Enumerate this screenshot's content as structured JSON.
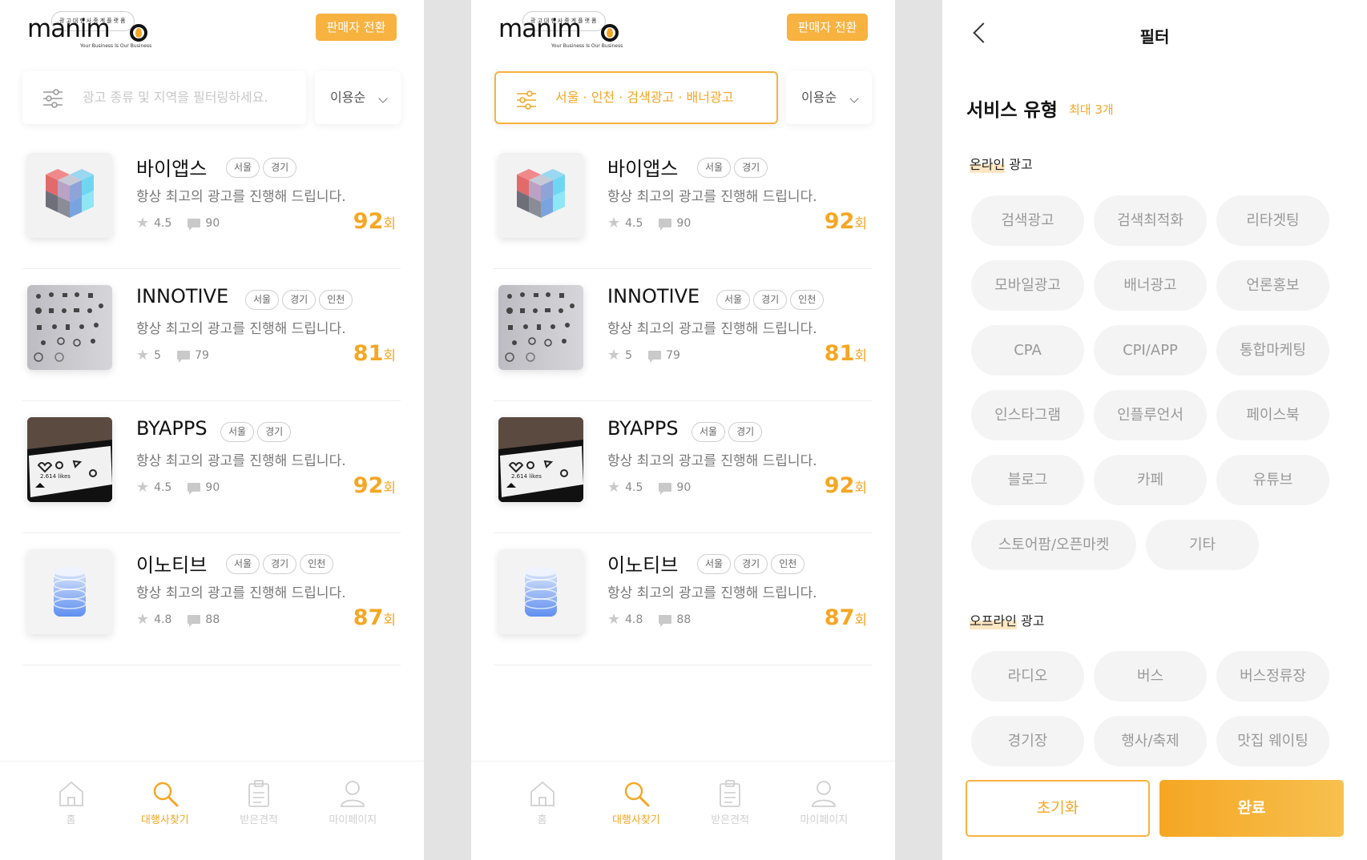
{
  "header": {
    "logo_word": "manim on",
    "logo_tagline": "광고대행사중계플랫폼",
    "logo_sub": "Your Business Is Our Business",
    "seller_switch": "판매자 전환"
  },
  "search": {
    "placeholder": "광고 종류 및 지역을 필터링하세요.",
    "applied": "서울 · 인천 · 검색광고 · 배너광고",
    "sort": "이용순"
  },
  "agencies": [
    {
      "name": "바이앱스",
      "tags": [
        "서울",
        "경기"
      ],
      "desc": "항상 최고의 광고를 진행해 드립니다.",
      "rating": "4.5",
      "reviews": "90",
      "count": "92",
      "unit": "회",
      "thumb": "cube"
    },
    {
      "name": "INNOTIVE",
      "tags": [
        "서울",
        "경기",
        "인천"
      ],
      "desc": "항상 최고의 광고를 진행해 드립니다.",
      "rating": "5",
      "reviews": "79",
      "count": "81",
      "unit": "회",
      "thumb": "icons"
    },
    {
      "name": "BYAPPS",
      "tags": [
        "서울",
        "경기"
      ],
      "desc": "항상 최고의 광고를 진행해 드립니다.",
      "rating": "4.5",
      "reviews": "90",
      "count": "92",
      "unit": "회",
      "thumb": "phone"
    },
    {
      "name": "이노티브",
      "tags": [
        "서울",
        "경기",
        "인천"
      ],
      "desc": "항상 최고의 광고를 진행해 드립니다.",
      "rating": "4.8",
      "reviews": "88",
      "count": "87",
      "unit": "회",
      "thumb": "disks"
    }
  ],
  "tabbar": [
    {
      "label": "홈",
      "icon": "home-icon",
      "active": false
    },
    {
      "label": "대행사찾기",
      "icon": "search-icon",
      "active": true
    },
    {
      "label": "받은견적",
      "icon": "clipboard-icon",
      "active": false
    },
    {
      "label": "마이페이지",
      "icon": "user-icon",
      "active": false
    }
  ],
  "filter": {
    "title": "필터",
    "section_title": "서비스 유형",
    "section_max": "최대 3개",
    "online": {
      "label_hl": "온라인",
      "label_rest": " 광고",
      "options": [
        "검색광고",
        "검색최적화",
        "리타겟팅",
        "모바일광고",
        "배너광고",
        "언론홍보",
        "CPA",
        "CPI/APP",
        "통합마케팅",
        "인스타그램",
        "인플루언서",
        "페이스북",
        "블로그",
        "카페",
        "유튜브",
        "스토어팜/오픈마켓",
        "기타"
      ]
    },
    "offline": {
      "label_hl": "오프라인",
      "label_rest": " 광고",
      "options": [
        "라디오",
        "버스",
        "버스정류장",
        "경기장",
        "행사/축제",
        "맛집 웨이팅"
      ]
    },
    "reset": "초기화",
    "done": "완료"
  },
  "colors": {
    "accent": "#f5a623",
    "chip_bg": "#f4f4f4"
  }
}
